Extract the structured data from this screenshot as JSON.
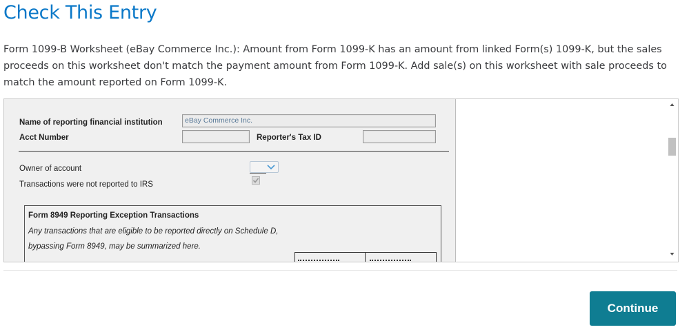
{
  "page": {
    "title": "Check This Entry",
    "message": "Form 1099-B Worksheet (eBay Commerce Inc.): Amount from Form 1099-K has an amount from linked Form(s) 1099-K, but the sales proceeds on this worksheet don't match the payment amount from Form 1099-K. Add sale(s) on this worksheet with sale proceeds to match the amount reported on Form 1099-K."
  },
  "form": {
    "institution_label": "Name of reporting financial institution",
    "institution_value": "eBay Commerce Inc.",
    "acct_label": "Acct Number",
    "acct_value": "",
    "tax_id_label": "Reporter's Tax ID",
    "tax_id_value": "",
    "owner_label": "Owner of account",
    "owner_value": "",
    "not_reported_label": "Transactions were not reported to IRS",
    "not_reported_checked": true,
    "exception_box": {
      "title": "Form 8949 Reporting Exception Transactions",
      "line1": "Any transactions that are eligible to be reported directly on Schedule D,",
      "line2": "bypassing Form 8949, may be summarized here."
    }
  },
  "actions": {
    "continue_label": "Continue"
  },
  "colors": {
    "title": "#0a78c8",
    "button": "#0f7d92",
    "form_bg": "#f0f0f0"
  }
}
